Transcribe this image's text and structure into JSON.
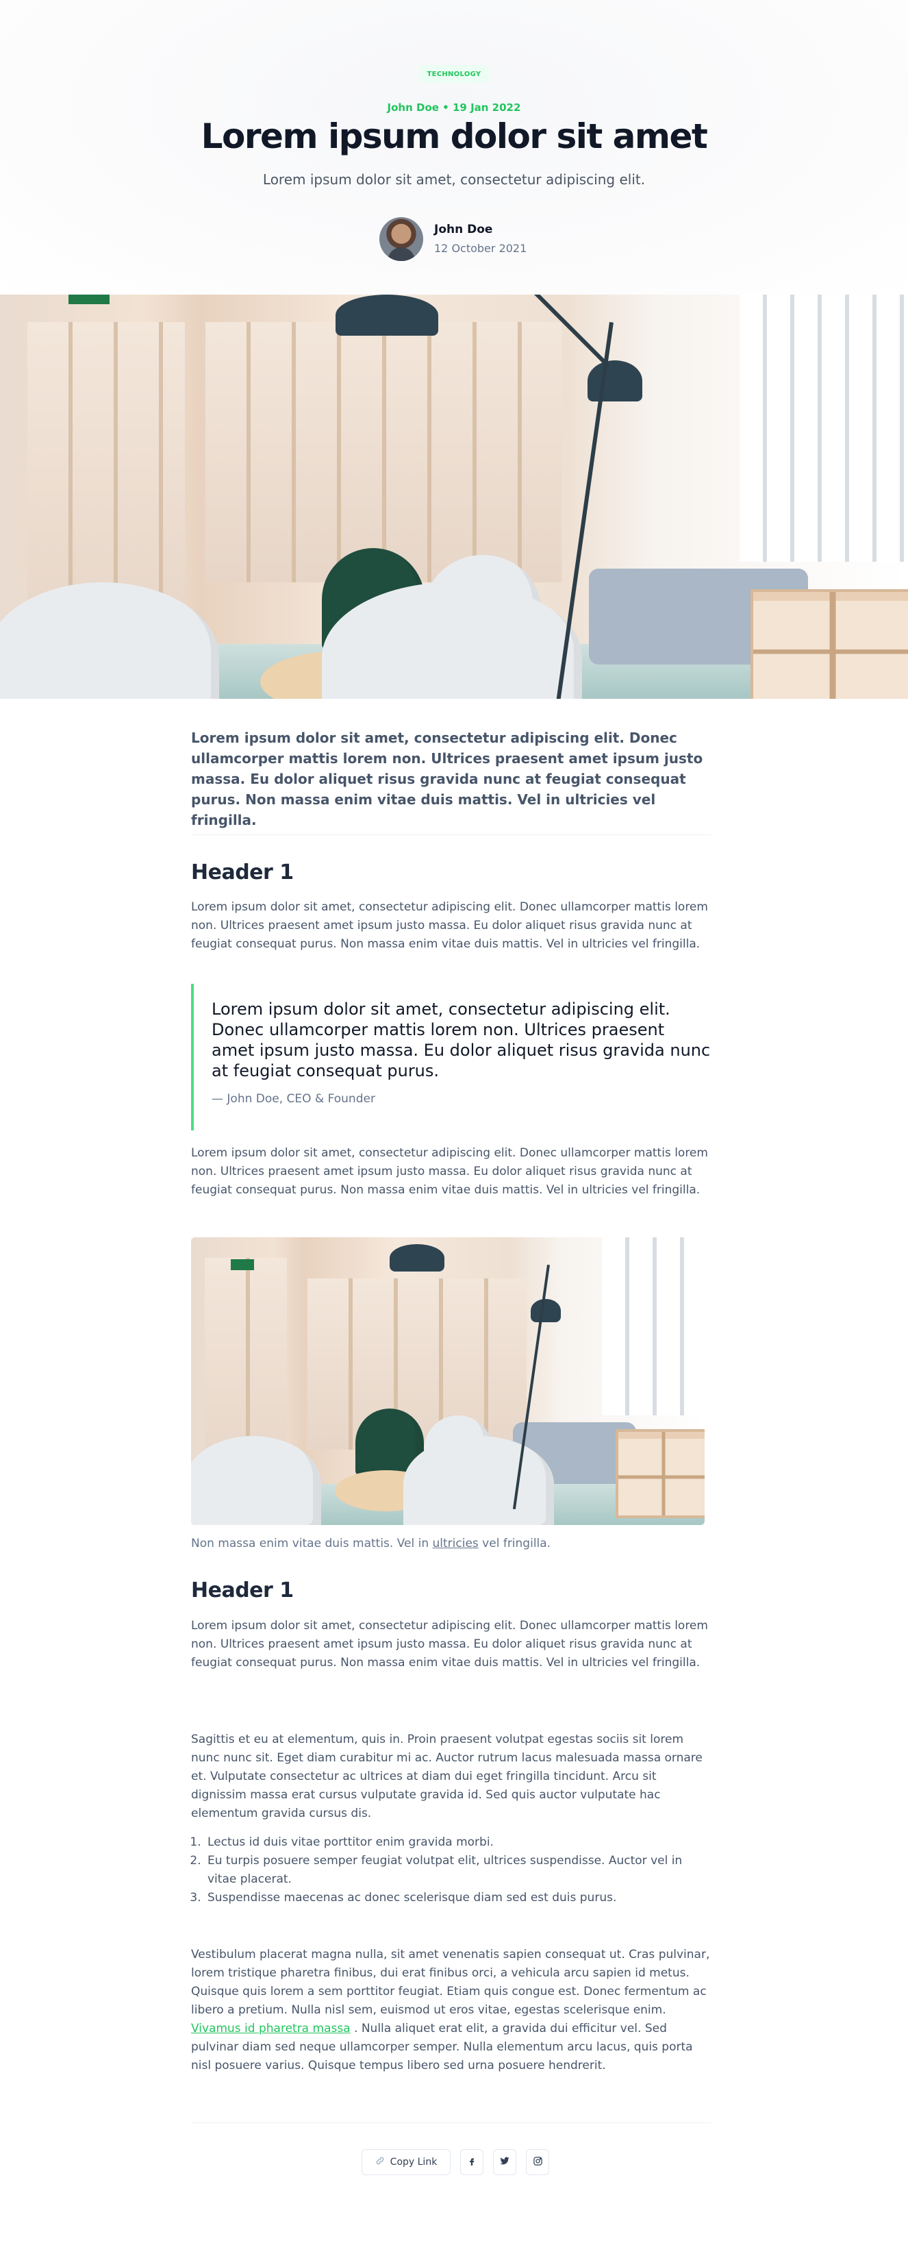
{
  "hero": {
    "tag": "TECHNOLOGY",
    "meta": "John Doe • 19 Jan 2022",
    "title": "Lorem ipsum dolor sit amet",
    "subtitle": "Lorem ipsum dolor sit amet, consectetur adipiscing elit.",
    "author": {
      "name": "John Doe",
      "date": "12 October 2021"
    }
  },
  "images": {
    "hero_photo": "office-interior-photo",
    "inline_photo": "office-interior-photo"
  },
  "article": {
    "lead": "Lorem ipsum dolor sit amet, consectetur adipiscing elit. Donec ullamcorper mattis lorem non. Ultrices praesent amet ipsum justo massa. Eu dolor aliquet risus gravida nunc at feugiat consequat purus. Non massa enim vitae duis mattis. Vel in ultricies vel fringilla.",
    "section1": {
      "heading": "Header 1",
      "para1": "Lorem ipsum dolor sit amet, consectetur adipiscing elit. Donec ullamcorper mattis lorem non. Ultrices praesent amet ipsum justo massa. Eu dolor aliquet risus gravida nunc at feugiat consequat purus. Non massa enim vitae duis mattis. Vel in ultricies vel fringilla.",
      "quote": "Lorem ipsum dolor sit amet, consectetur adipiscing elit. Donec ullamcorper mattis lorem non. Ultrices praesent amet ipsum justo massa. Eu dolor aliquet risus gravida nunc at feugiat consequat purus.",
      "quote_cite": "— John Doe, CEO & Founder",
      "para2": "Lorem ipsum dolor sit amet, consectetur adipiscing elit. Donec ullamcorper mattis lorem non. Ultrices praesent amet ipsum justo massa. Eu dolor aliquet risus gravida nunc at feugiat consequat purus. Non massa enim vitae duis mattis. Vel in ultricies vel fringilla.",
      "caption_before": "Non massa enim vitae duis mattis. Vel in ",
      "caption_link": "ultricies",
      "caption_after": " vel fringilla."
    },
    "section2": {
      "heading": "Header 1",
      "para1": "Lorem ipsum dolor sit amet, consectetur adipiscing elit. Donec ullamcorper mattis lorem non. Ultrices praesent amet ipsum justo massa. Eu dolor aliquet risus gravida nunc at feugiat consequat purus. Non massa enim vitae duis mattis. Vel in ultricies vel fringilla.",
      "para2": "Sagittis et eu at elementum, quis in. Proin praesent volutpat egestas sociis sit lorem nunc nunc sit. Eget diam curabitur mi ac. Auctor rutrum lacus malesuada massa ornare et. Vulputate consectetur ac ultrices at diam dui eget fringilla tincidunt. Arcu sit dignissim massa erat cursus vulputate gravida id. Sed quis auctor vulputate hac elementum gravida cursus dis.",
      "list": [
        "Lectus id duis vitae porttitor enim gravida morbi.",
        "Eu turpis posuere semper feugiat volutpat elit, ultrices suspendisse. Auctor vel in vitae placerat.",
        "Suspendisse maecenas ac donec scelerisque diam sed est duis purus."
      ],
      "para3_before": "Vestibulum placerat magna nulla, sit amet venenatis sapien consequat ut. Cras pulvinar, lorem tristique pharetra finibus, dui erat finibus orci, a vehicula arcu sapien id metus. Quisque quis lorem a sem porttitor feugiat. Etiam quis congue est. Donec fermentum ac libero a pretium. Nulla nisl sem, euismod ut eros vitae, egestas scelerisque enim. ",
      "para3_link": "Vivamus id pharetra massa",
      "para3_after": " . Nulla aliquet erat elit, a gravida dui efficitur vel. Sed pulvinar diam sed neque ullamcorper semper. Nulla elementum arcu lacus, quis porta nisl posuere varius. Quisque tempus libero sed urna posuere hendrerit."
    }
  },
  "share": {
    "copy_label": "Copy Link",
    "icons": [
      "link-icon",
      "facebook-icon",
      "twitter-icon",
      "instagram-icon"
    ]
  },
  "colors": {
    "accent": "#22c55e",
    "heading": "#111827",
    "body": "#475569"
  }
}
